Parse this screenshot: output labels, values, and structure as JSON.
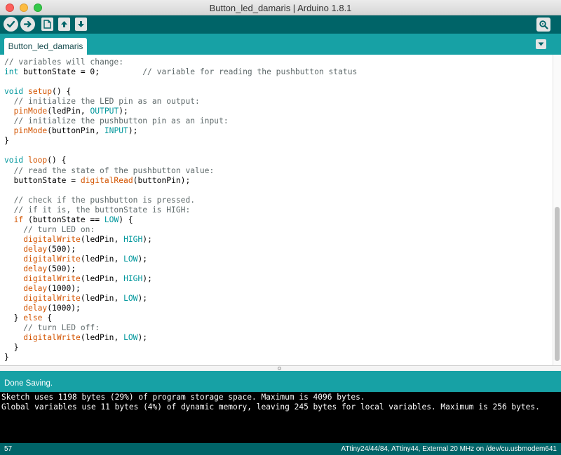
{
  "window": {
    "title": "Button_led_damaris | Arduino 1.8.1"
  },
  "toolbar": {
    "icons": [
      "verify-icon",
      "upload-icon",
      "new-icon",
      "open-icon",
      "save-icon",
      "serial-monitor-icon"
    ]
  },
  "tab": {
    "label": "Button_led_damaris"
  },
  "editor": {
    "lines": [
      [
        [
          "cm",
          "// variables will change:"
        ]
      ],
      [
        [
          "ty",
          "int"
        ],
        [
          "tx",
          " buttonState = 0;         "
        ],
        [
          "cm",
          "// variable for reading the pushbutton status"
        ]
      ],
      [
        [
          "tx",
          ""
        ]
      ],
      [
        [
          "ty",
          "void"
        ],
        [
          "tx",
          " "
        ],
        [
          "fn",
          "setup"
        ],
        [
          "tx",
          "() {"
        ]
      ],
      [
        [
          "tx",
          "  "
        ],
        [
          "cm",
          "// initialize the LED pin as an output:"
        ]
      ],
      [
        [
          "tx",
          "  "
        ],
        [
          "fn",
          "pinMode"
        ],
        [
          "tx",
          "(ledPin, "
        ],
        [
          "ct",
          "OUTPUT"
        ],
        [
          "tx",
          ");"
        ]
      ],
      [
        [
          "tx",
          "  "
        ],
        [
          "cm",
          "// initialize the pushbutton pin as an input:"
        ]
      ],
      [
        [
          "tx",
          "  "
        ],
        [
          "fn",
          "pinMode"
        ],
        [
          "tx",
          "(buttonPin, "
        ],
        [
          "ct",
          "INPUT"
        ],
        [
          "tx",
          ");"
        ]
      ],
      [
        [
          "tx",
          "}"
        ]
      ],
      [
        [
          "tx",
          ""
        ]
      ],
      [
        [
          "ty",
          "void"
        ],
        [
          "tx",
          " "
        ],
        [
          "fn",
          "loop"
        ],
        [
          "tx",
          "() {"
        ]
      ],
      [
        [
          "tx",
          "  "
        ],
        [
          "cm",
          "// read the state of the pushbutton value:"
        ]
      ],
      [
        [
          "tx",
          "  buttonState = "
        ],
        [
          "fn",
          "digitalRead"
        ],
        [
          "tx",
          "(buttonPin);"
        ]
      ],
      [
        [
          "tx",
          ""
        ]
      ],
      [
        [
          "tx",
          "  "
        ],
        [
          "cm",
          "// check if the pushbutton is pressed."
        ]
      ],
      [
        [
          "tx",
          "  "
        ],
        [
          "cm",
          "// if it is, the buttonState is HIGH:"
        ]
      ],
      [
        [
          "tx",
          "  "
        ],
        [
          "fn",
          "if"
        ],
        [
          "tx",
          " (buttonState == "
        ],
        [
          "ct",
          "LOW"
        ],
        [
          "tx",
          ") {"
        ]
      ],
      [
        [
          "tx",
          "    "
        ],
        [
          "cm",
          "// turn LED on:"
        ]
      ],
      [
        [
          "tx",
          "    "
        ],
        [
          "fn",
          "digitalWrite"
        ],
        [
          "tx",
          "(ledPin, "
        ],
        [
          "ct",
          "HIGH"
        ],
        [
          "tx",
          ");"
        ]
      ],
      [
        [
          "tx",
          "    "
        ],
        [
          "fn",
          "delay"
        ],
        [
          "tx",
          "(500);"
        ]
      ],
      [
        [
          "tx",
          "    "
        ],
        [
          "fn",
          "digitalWrite"
        ],
        [
          "tx",
          "(ledPin, "
        ],
        [
          "ct",
          "LOW"
        ],
        [
          "tx",
          ");"
        ]
      ],
      [
        [
          "tx",
          "    "
        ],
        [
          "fn",
          "delay"
        ],
        [
          "tx",
          "(500);"
        ]
      ],
      [
        [
          "tx",
          "    "
        ],
        [
          "fn",
          "digitalWrite"
        ],
        [
          "tx",
          "(ledPin, "
        ],
        [
          "ct",
          "HIGH"
        ],
        [
          "tx",
          ");"
        ]
      ],
      [
        [
          "tx",
          "    "
        ],
        [
          "fn",
          "delay"
        ],
        [
          "tx",
          "(1000);"
        ]
      ],
      [
        [
          "tx",
          "    "
        ],
        [
          "fn",
          "digitalWrite"
        ],
        [
          "tx",
          "(ledPin, "
        ],
        [
          "ct",
          "LOW"
        ],
        [
          "tx",
          ");"
        ]
      ],
      [
        [
          "tx",
          "    "
        ],
        [
          "fn",
          "delay"
        ],
        [
          "tx",
          "(1000);"
        ]
      ],
      [
        [
          "tx",
          "  } "
        ],
        [
          "fn",
          "else"
        ],
        [
          "tx",
          " {"
        ]
      ],
      [
        [
          "tx",
          "    "
        ],
        [
          "cm",
          "// turn LED off:"
        ]
      ],
      [
        [
          "tx",
          "    "
        ],
        [
          "fn",
          "digitalWrite"
        ],
        [
          "tx",
          "(ledPin, "
        ],
        [
          "ct",
          "LOW"
        ],
        [
          "tx",
          ");"
        ]
      ],
      [
        [
          "tx",
          "  }"
        ]
      ],
      [
        [
          "tx",
          "}"
        ]
      ]
    ]
  },
  "status": {
    "message": "Done Saving."
  },
  "console": {
    "lines": [
      "Sketch uses 1198 bytes (29%) of program storage space. Maximum is 4096 bytes.",
      "Global variables use 11 bytes (4%) of dynamic memory, leaving 245 bytes for local variables. Maximum is 256 bytes."
    ]
  },
  "footer": {
    "line_number": "57",
    "board": "ATtiny24/44/84, ATtiny44, External 20 MHz on /dev/cu.usbmodem641"
  },
  "colors": {
    "toolbar": "#006468",
    "tab_bar": "#17a1a5",
    "comment": "#5f6a6b",
    "keyword_type": "#00979c",
    "function": "#d35400",
    "constant": "#00979c"
  }
}
